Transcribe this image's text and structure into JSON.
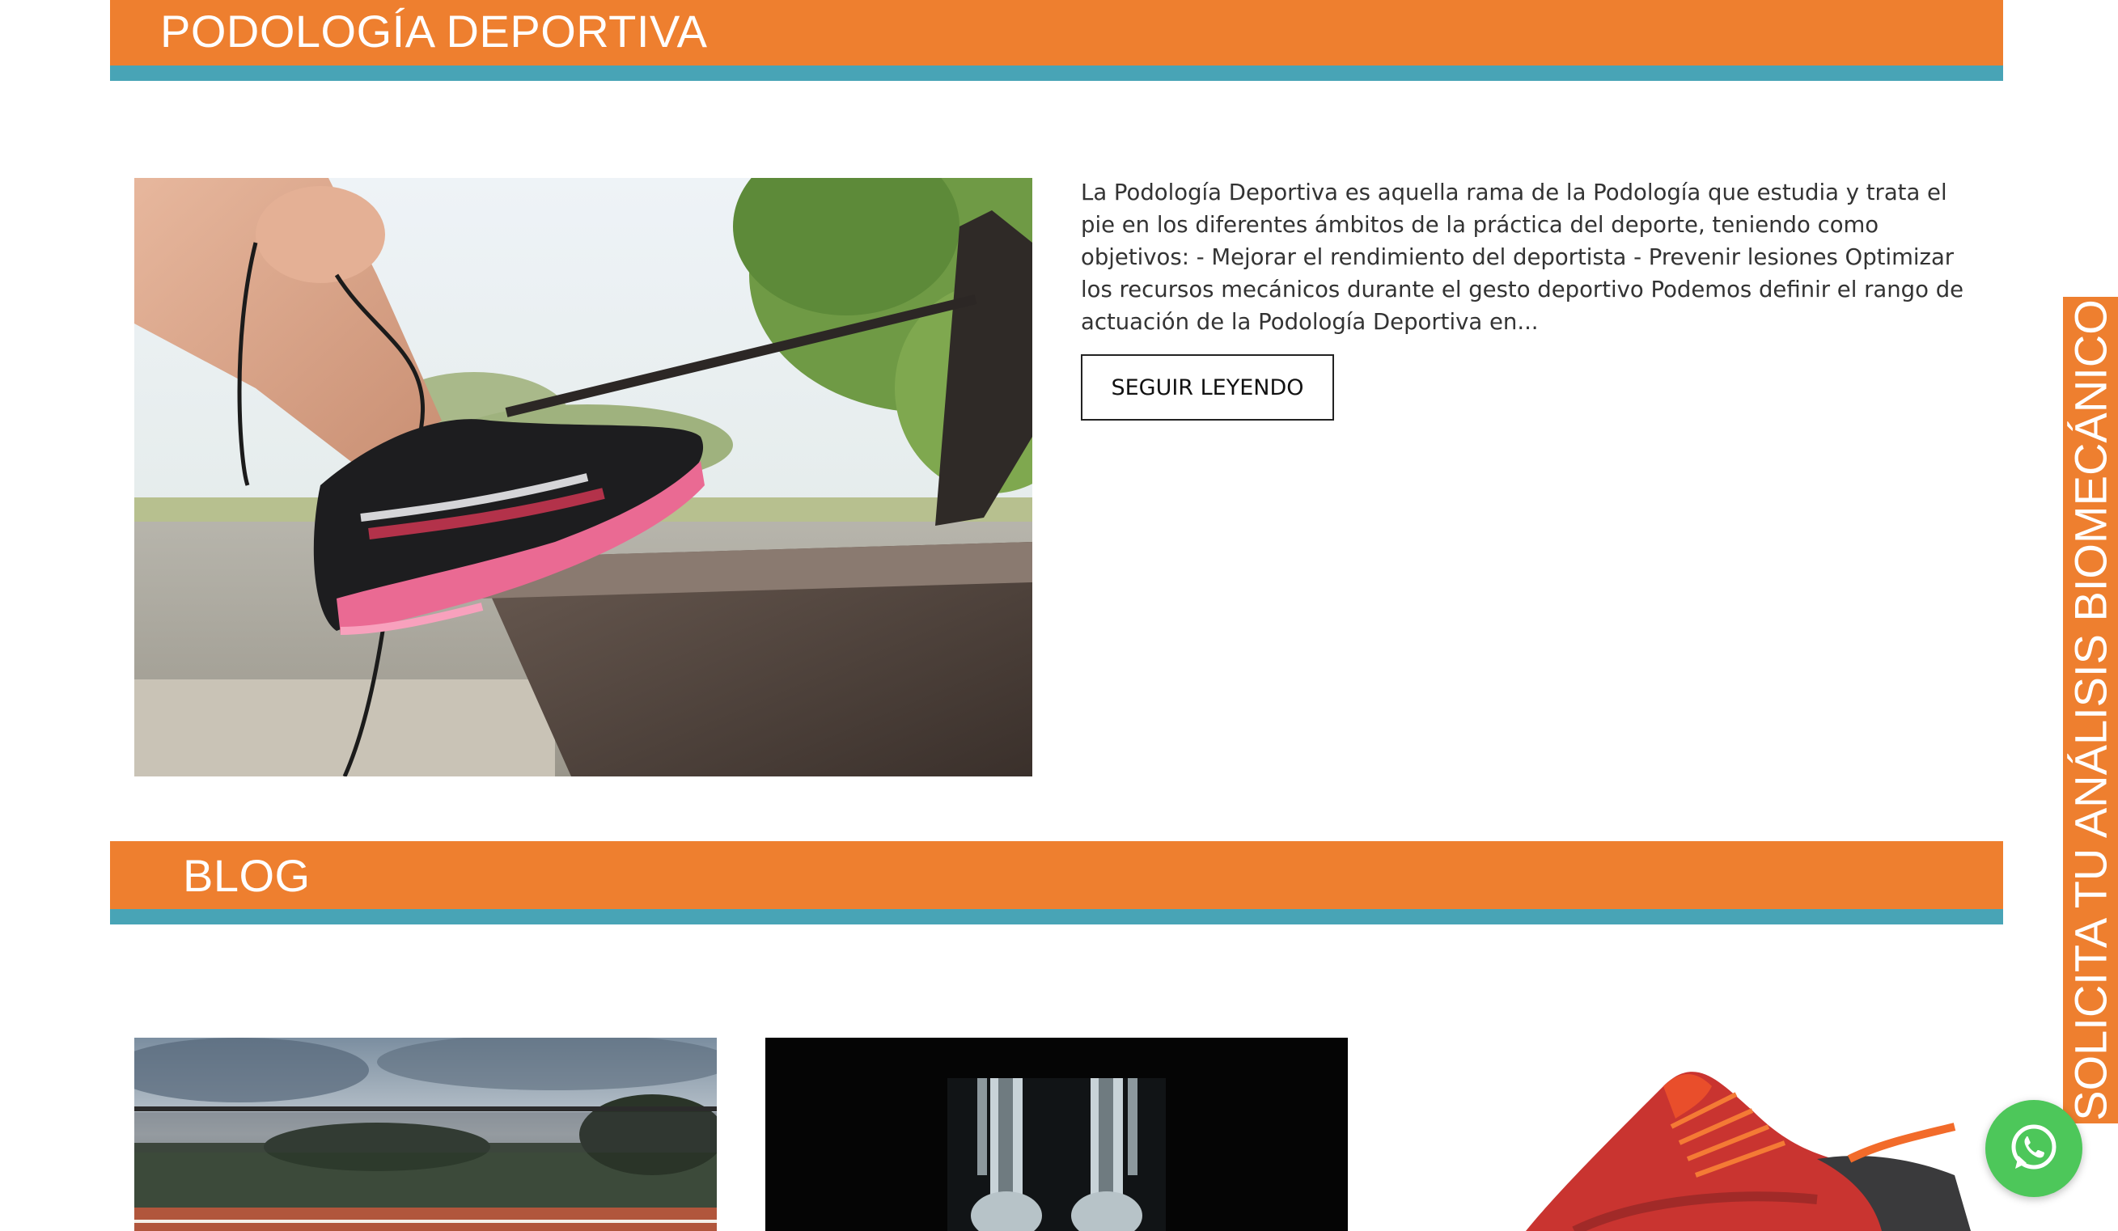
{
  "sections": {
    "podologia": {
      "title": "PODOLOGÍA DEPORTIVA",
      "excerpt": "La Podología Deportiva es aquella rama de la Podología que estudia y trata el pie en los diferentes ámbitos de la práctica del deporte, teniendo como objetivos: - Mejorar el rendimiento del deportista - Prevenir lesiones Optimizar los recursos mecánicos durante el gesto deportivo Podemos definir el rango de actuación de la Podología Deportiva en...",
      "read_more_label": "SEGUIR LEYENDO",
      "image": "running-shoe-photo"
    },
    "blog": {
      "title": "BLOG",
      "cards": [
        {
          "image": "tennis-court-photo"
        },
        {
          "image": "leg-xray-photo"
        },
        {
          "image": "red-trail-shoe-photo"
        }
      ]
    }
  },
  "side_tab": {
    "label": "SOLICITA TU ANÁLISIS BIOMECÁNICO"
  },
  "whatsapp": {
    "icon": "whatsapp-icon"
  },
  "colors": {
    "accent_orange": "#ee7f2f",
    "accent_teal": "#48a4b6",
    "whatsapp_green": "#4dc75a"
  }
}
